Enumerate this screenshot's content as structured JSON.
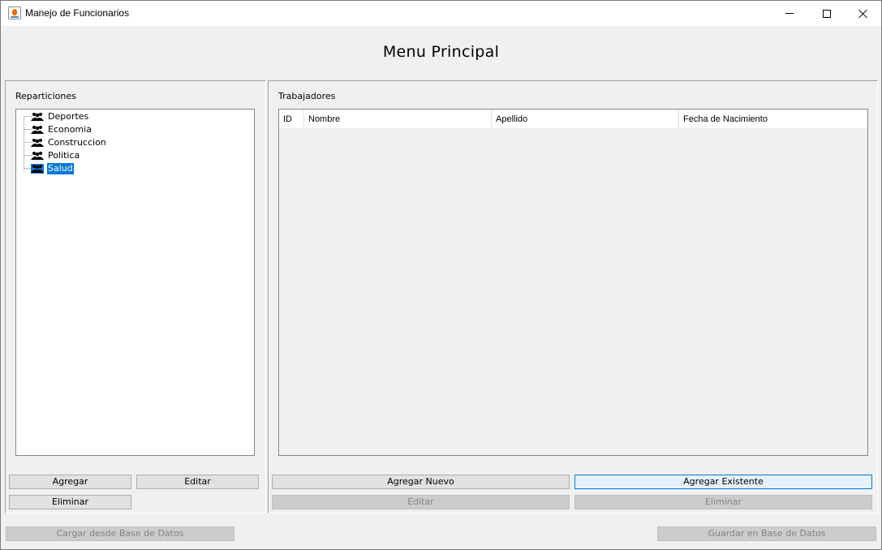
{
  "window": {
    "title": "Manejo de Funcionarios"
  },
  "header": {
    "title": "Menu Principal"
  },
  "left_panel": {
    "label": "Reparticiones",
    "tree_items": [
      {
        "label": "Deportes",
        "icon": "people-icon"
      },
      {
        "label": "Economia",
        "icon": "people-icon"
      },
      {
        "label": "Construccion",
        "icon": "people-icon"
      },
      {
        "label": "Politica",
        "icon": "people-icon"
      },
      {
        "label": "Salud",
        "icon": "people-icon",
        "selected": true
      }
    ],
    "buttons": {
      "add": "Agregar",
      "edit": "Editar",
      "delete": "Eliminar"
    }
  },
  "right_panel": {
    "label": "Trabajadores",
    "columns": [
      "ID",
      "Nombre",
      "Apellido",
      "Fecha de Nacimiento"
    ],
    "rows": [],
    "buttons": {
      "add_new": "Agregar Nuevo",
      "add_existing": "Agregar Existente",
      "edit": "Editar",
      "delete": "Eliminar"
    }
  },
  "footer": {
    "load_db": "Cargar desde Base de Datos",
    "save_db": "Guardar en Base de Datos"
  },
  "colors": {
    "selection": "#0078d7",
    "focus_border": "#0078d7"
  }
}
